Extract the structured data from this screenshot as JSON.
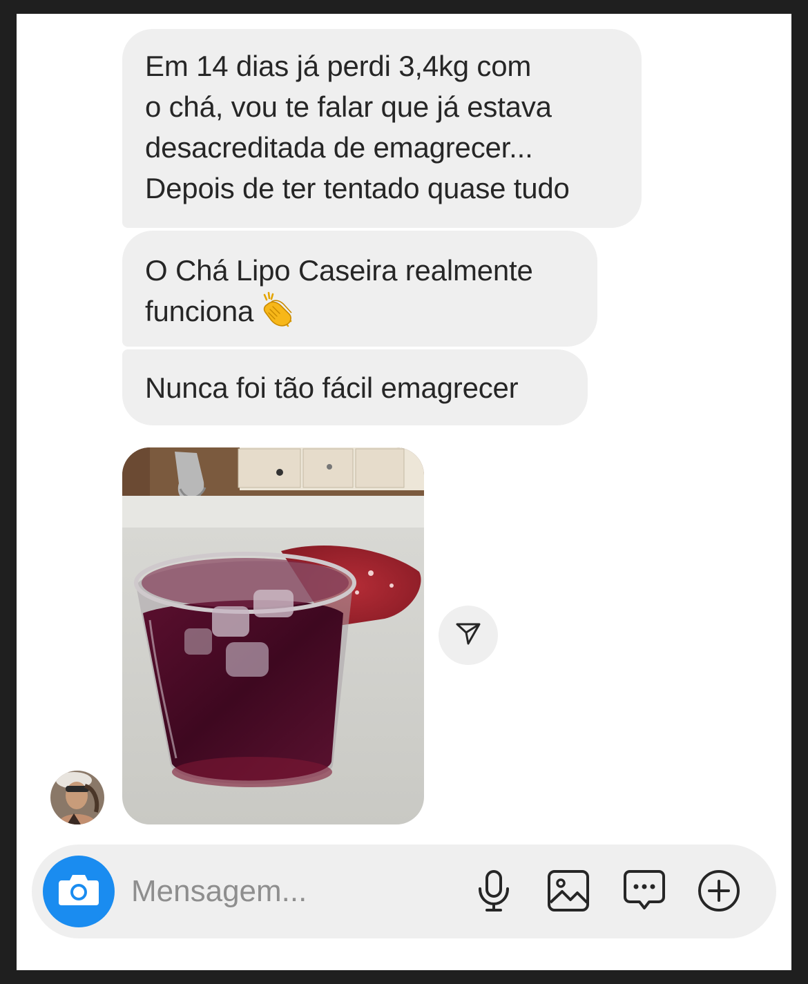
{
  "messages": [
    {
      "type": "text",
      "lines": [
        "Em 14 dias já perdi 3,4kg com",
        "o chá, vou te falar que já estava",
        "desacreditada de emagrecer...",
        "Depois de ter tentado quase tudo"
      ]
    },
    {
      "type": "text",
      "lines": [
        "O Chá Lipo Caseira realmente",
        "funciona"
      ],
      "emoji": "clapping-hands-icon"
    },
    {
      "type": "text",
      "lines": [
        "Nunca foi tão fácil emagrecer"
      ]
    },
    {
      "type": "image",
      "image": "glass-of-red-tea-with-ice-photo",
      "share_icon": "send-icon"
    }
  ],
  "composer": {
    "placeholder": "Mensagem...",
    "value": "",
    "icons": [
      "camera-icon",
      "microphone-icon",
      "gallery-icon",
      "sticker-icon",
      "plus-icon"
    ]
  },
  "colors": {
    "bubble": "#efefef",
    "text": "#262626",
    "accent": "#1a8cf0",
    "placeholder": "#8e8e8e"
  }
}
